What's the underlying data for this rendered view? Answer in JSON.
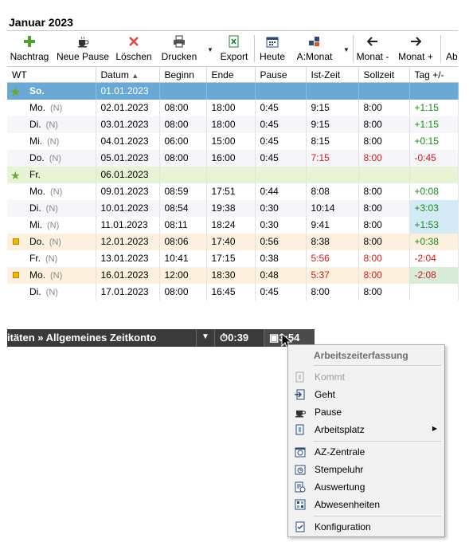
{
  "title": "Januar 2023",
  "toolbar": {
    "nachtrag": "Nachtrag",
    "neue_pause": "Neue Pause",
    "loeschen": "Löschen",
    "drucken": "Drucken",
    "export": "Export",
    "heute": "Heute",
    "amonat": "A:Monat",
    "monat_minus": "Monat -",
    "monat_plus": "Monat +",
    "ab": "Ab"
  },
  "columns": [
    "WT",
    "Datum",
    "Beginn",
    "Ende",
    "Pause",
    "Ist-Zeit",
    "Sollzeit",
    "Tag +/-"
  ],
  "rows": [
    {
      "wt": "So.",
      "n": "",
      "datum": "01.01.2023",
      "beginn": "",
      "ende": "",
      "pause": "",
      "ist": "",
      "soll": "",
      "tag": ""
    },
    {
      "wt": "Mo.",
      "n": "(N)",
      "datum": "02.01.2023",
      "beginn": "08:00",
      "ende": "18:00",
      "pause": "0:45",
      "ist": "9:15",
      "soll": "8:00",
      "tag": "+1:15"
    },
    {
      "wt": "Di.",
      "n": "(N)",
      "datum": "03.01.2023",
      "beginn": "08:00",
      "ende": "18:00",
      "pause": "0:45",
      "ist": "9:15",
      "soll": "8:00",
      "tag": "+1:15"
    },
    {
      "wt": "Mi.",
      "n": "(N)",
      "datum": "04.01.2023",
      "beginn": "06:00",
      "ende": "15:00",
      "pause": "0:45",
      "ist": "8:15",
      "soll": "8:00",
      "tag": "+0:15"
    },
    {
      "wt": "Do.",
      "n": "(N)",
      "datum": "05.01.2023",
      "beginn": "08:00",
      "ende": "16:00",
      "pause": "0:45",
      "ist": "7:15",
      "soll": "8:00",
      "tag": "-0:45"
    },
    {
      "wt": "Fr.",
      "n": "",
      "datum": "06.01.2023",
      "beginn": "",
      "ende": "",
      "pause": "",
      "ist": "",
      "soll": "",
      "tag": ""
    },
    {
      "wt": "Mo.",
      "n": "(N)",
      "datum": "09.01.2023",
      "beginn": "08:59",
      "ende": "17:51",
      "pause": "0:44",
      "ist": "8:08",
      "soll": "8:00",
      "tag": "+0:08"
    },
    {
      "wt": "Di.",
      "n": "(N)",
      "datum": "10.01.2023",
      "beginn": "08:54",
      "ende": "19:38",
      "pause": "0:30",
      "ist": "10:14",
      "soll": "8:00",
      "tag": "+3:03"
    },
    {
      "wt": "Mi.",
      "n": "(N)",
      "datum": "11.01.2023",
      "beginn": "08:11",
      "ende": "18:24",
      "pause": "0:30",
      "ist": "9:41",
      "soll": "8:00",
      "tag": "+1:53"
    },
    {
      "wt": "Do.",
      "n": "(N)",
      "datum": "12.01.2023",
      "beginn": "08:06",
      "ende": "17:40",
      "pause": "0:56",
      "ist": "8:38",
      "soll": "8:00",
      "tag": "+0:38"
    },
    {
      "wt": "Fr.",
      "n": "(N)",
      "datum": "13.01.2023",
      "beginn": "10:41",
      "ende": "17:15",
      "pause": "0:38",
      "ist": "5:56",
      "soll": "8:00",
      "tag": "-2:04"
    },
    {
      "wt": "Mo.",
      "n": "(N)",
      "datum": "16.01.2023",
      "beginn": "12:00",
      "ende": "18:30",
      "pause": "0:48",
      "ist": "5:37",
      "soll": "8:00",
      "tag": "-2:08"
    },
    {
      "wt": "Di.",
      "n": "(N)",
      "datum": "17.01.2023",
      "beginn": "08:00",
      "ende": "16:45",
      "pause": "0:45",
      "ist": "8:00",
      "soll": "8:00",
      "tag": ""
    }
  ],
  "taskbar": {
    "crumb": "itäten » Allgemeines Zeitkonto",
    "timer1": "0:39",
    "timer2": "3:54"
  },
  "menu": {
    "header": "Arbeitszeiterfassung",
    "kommt": "Kommt",
    "geht": "Geht",
    "pause": "Pause",
    "arbeitsplatz": "Arbeitsplatz",
    "az_zentrale": "AZ-Zentrale",
    "stempeluhr": "Stempeluhr",
    "auswertung": "Auswertung",
    "abwesenheiten": "Abwesenheiten",
    "konfiguration": "Konfiguration"
  },
  "colors": {
    "selected_row": "#6aa9d6",
    "holiday_row": "#e8f3d6",
    "marked_row": "#fdf0de",
    "negative": "#d01b1b",
    "positive": "#1a8a1a"
  }
}
